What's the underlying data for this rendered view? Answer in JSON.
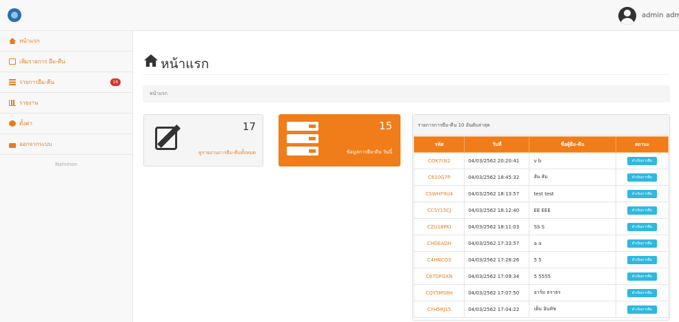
{
  "topbar": {
    "user_name": "admin",
    "user_name2": "admi"
  },
  "sidebar": {
    "items": [
      {
        "label": "หน้าแรก",
        "icon": "home-icon"
      },
      {
        "label": "เพิ่มรายการ ยืม-คืน",
        "icon": "edit-icon"
      },
      {
        "label": "รายการยืม-คืน",
        "icon": "list-icon",
        "badge": "16"
      },
      {
        "label": "รายงาน",
        "icon": "bar-chart-icon"
      },
      {
        "label": "ตั้งค่า",
        "icon": "gear-icon"
      },
      {
        "label": "ออกจากระบบ",
        "icon": "lock-icon"
      }
    ],
    "footer": "Nammon"
  },
  "main": {
    "title": "หน้าแรก",
    "breadcrumb": "หน้าแรก",
    "panels": {
      "total": {
        "value": "17",
        "label": "ดูรายงานการยืม-คืนทั้งหมด"
      },
      "today": {
        "value": "15",
        "label": "ข้อมูลการยืม-คืน วันนี้"
      }
    },
    "table": {
      "heading": "รายการการยืม-คืน 10 อันดับล่าสุด",
      "columns": [
        "รหัส",
        "วันที่",
        "ชื่อผู้ยืม-คืน",
        "สถานะ"
      ],
      "rows": [
        {
          "code": "COK7I3I2",
          "date": "04/03/2562 20:20:41",
          "name": "v  b",
          "status": "ดำเนินการยืม"
        },
        {
          "code": "C610G7P",
          "date": "04/03/2562 18:45:32",
          "name": "ส้ม  ส้ม",
          "status": "ดำเนินการยืม"
        },
        {
          "code": "CSWHF9U4",
          "date": "04/03/2562 18:13:57",
          "name": "test  test",
          "status": "ดำเนินการยืม"
        },
        {
          "code": "CCSY15CJ",
          "date": "04/03/2562 18:12:40",
          "name": "EE  EEE",
          "status": "ดำเนินการยืม"
        },
        {
          "code": "CZU18PKI",
          "date": "04/03/2562 18:11:03",
          "name": "SS  S",
          "status": "ดำเนินการยืม"
        },
        {
          "code": "CHGEADH",
          "date": "04/03/2562 17:33:57",
          "name": "a  a",
          "status": "ดำเนินการยืม"
        },
        {
          "code": "C4HNCO3",
          "date": "04/03/2562 17:28:26",
          "name": "5  5",
          "status": "ดำเนินการยืม"
        },
        {
          "code": "C67DFGXN",
          "date": "04/03/2562 17:09:34",
          "name": "5  5555",
          "status": "ดำเนินการยืม"
        },
        {
          "code": "CQY5MS8H",
          "date": "04/03/2562 17:07:50",
          "name": "อาร์ม  ธราธร",
          "status": "ดำเนินการยืม"
        },
        {
          "code": "CYH5RJ15",
          "date": "04/03/2562 17:04:22",
          "name": "เต็ม  อินทัช",
          "status": "ดำเนินการยืม"
        }
      ]
    }
  },
  "colors": {
    "accent": "#f07d1a",
    "status": "#2fb8e0",
    "badge": "#d9322a"
  }
}
